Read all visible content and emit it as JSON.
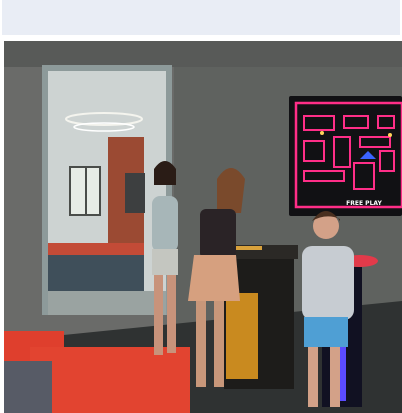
{
  "header": {
    "color": "#e9edf5"
  },
  "photo": {
    "subject": "arcade-game-room",
    "arcade_screen_text": "FREE PLAY",
    "colors": {
      "wall": "#6b6b68",
      "doorway_trim": "#8fa6ad",
      "screen_neon": "#ff2e88",
      "screen_blue": "#3b63ff",
      "sofa_red": "#e14331",
      "floor": "#2e3131"
    }
  }
}
